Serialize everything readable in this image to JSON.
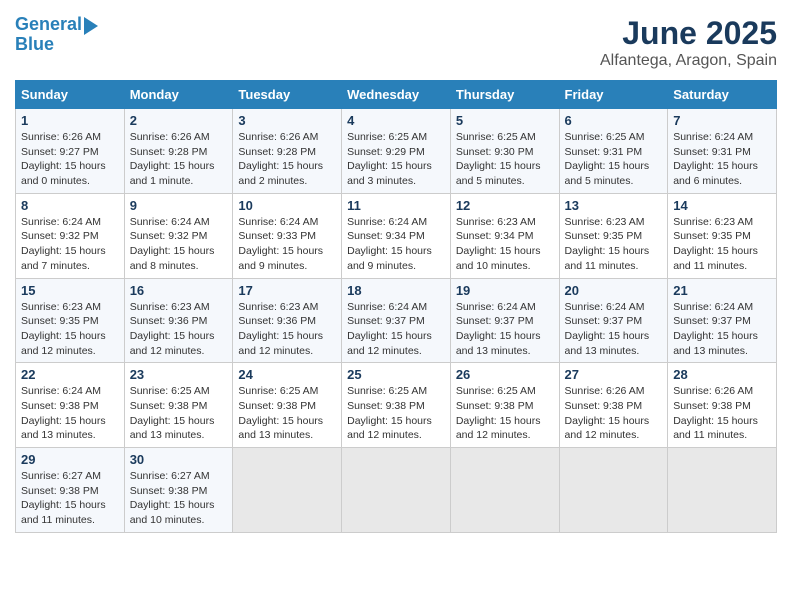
{
  "logo": {
    "line1": "General",
    "line2": "Blue"
  },
  "title": "June 2025",
  "subtitle": "Alfantega, Aragon, Spain",
  "days_of_week": [
    "Sunday",
    "Monday",
    "Tuesday",
    "Wednesday",
    "Thursday",
    "Friday",
    "Saturday"
  ],
  "weeks": [
    [
      {
        "day": 1,
        "info": "Sunrise: 6:26 AM\nSunset: 9:27 PM\nDaylight: 15 hours\nand 0 minutes."
      },
      {
        "day": 2,
        "info": "Sunrise: 6:26 AM\nSunset: 9:28 PM\nDaylight: 15 hours\nand 1 minute."
      },
      {
        "day": 3,
        "info": "Sunrise: 6:26 AM\nSunset: 9:28 PM\nDaylight: 15 hours\nand 2 minutes."
      },
      {
        "day": 4,
        "info": "Sunrise: 6:25 AM\nSunset: 9:29 PM\nDaylight: 15 hours\nand 3 minutes."
      },
      {
        "day": 5,
        "info": "Sunrise: 6:25 AM\nSunset: 9:30 PM\nDaylight: 15 hours\nand 5 minutes."
      },
      {
        "day": 6,
        "info": "Sunrise: 6:25 AM\nSunset: 9:31 PM\nDaylight: 15 hours\nand 5 minutes."
      },
      {
        "day": 7,
        "info": "Sunrise: 6:24 AM\nSunset: 9:31 PM\nDaylight: 15 hours\nand 6 minutes."
      }
    ],
    [
      {
        "day": 8,
        "info": "Sunrise: 6:24 AM\nSunset: 9:32 PM\nDaylight: 15 hours\nand 7 minutes."
      },
      {
        "day": 9,
        "info": "Sunrise: 6:24 AM\nSunset: 9:32 PM\nDaylight: 15 hours\nand 8 minutes."
      },
      {
        "day": 10,
        "info": "Sunrise: 6:24 AM\nSunset: 9:33 PM\nDaylight: 15 hours\nand 9 minutes."
      },
      {
        "day": 11,
        "info": "Sunrise: 6:24 AM\nSunset: 9:34 PM\nDaylight: 15 hours\nand 9 minutes."
      },
      {
        "day": 12,
        "info": "Sunrise: 6:23 AM\nSunset: 9:34 PM\nDaylight: 15 hours\nand 10 minutes."
      },
      {
        "day": 13,
        "info": "Sunrise: 6:23 AM\nSunset: 9:35 PM\nDaylight: 15 hours\nand 11 minutes."
      },
      {
        "day": 14,
        "info": "Sunrise: 6:23 AM\nSunset: 9:35 PM\nDaylight: 15 hours\nand 11 minutes."
      }
    ],
    [
      {
        "day": 15,
        "info": "Sunrise: 6:23 AM\nSunset: 9:35 PM\nDaylight: 15 hours\nand 12 minutes."
      },
      {
        "day": 16,
        "info": "Sunrise: 6:23 AM\nSunset: 9:36 PM\nDaylight: 15 hours\nand 12 minutes."
      },
      {
        "day": 17,
        "info": "Sunrise: 6:23 AM\nSunset: 9:36 PM\nDaylight: 15 hours\nand 12 minutes."
      },
      {
        "day": 18,
        "info": "Sunrise: 6:24 AM\nSunset: 9:37 PM\nDaylight: 15 hours\nand 12 minutes."
      },
      {
        "day": 19,
        "info": "Sunrise: 6:24 AM\nSunset: 9:37 PM\nDaylight: 15 hours\nand 13 minutes."
      },
      {
        "day": 20,
        "info": "Sunrise: 6:24 AM\nSunset: 9:37 PM\nDaylight: 15 hours\nand 13 minutes."
      },
      {
        "day": 21,
        "info": "Sunrise: 6:24 AM\nSunset: 9:37 PM\nDaylight: 15 hours\nand 13 minutes."
      }
    ],
    [
      {
        "day": 22,
        "info": "Sunrise: 6:24 AM\nSunset: 9:38 PM\nDaylight: 15 hours\nand 13 minutes."
      },
      {
        "day": 23,
        "info": "Sunrise: 6:25 AM\nSunset: 9:38 PM\nDaylight: 15 hours\nand 13 minutes."
      },
      {
        "day": 24,
        "info": "Sunrise: 6:25 AM\nSunset: 9:38 PM\nDaylight: 15 hours\nand 13 minutes."
      },
      {
        "day": 25,
        "info": "Sunrise: 6:25 AM\nSunset: 9:38 PM\nDaylight: 15 hours\nand 12 minutes."
      },
      {
        "day": 26,
        "info": "Sunrise: 6:25 AM\nSunset: 9:38 PM\nDaylight: 15 hours\nand 12 minutes."
      },
      {
        "day": 27,
        "info": "Sunrise: 6:26 AM\nSunset: 9:38 PM\nDaylight: 15 hours\nand 12 minutes."
      },
      {
        "day": 28,
        "info": "Sunrise: 6:26 AM\nSunset: 9:38 PM\nDaylight: 15 hours\nand 11 minutes."
      }
    ],
    [
      {
        "day": 29,
        "info": "Sunrise: 6:27 AM\nSunset: 9:38 PM\nDaylight: 15 hours\nand 11 minutes."
      },
      {
        "day": 30,
        "info": "Sunrise: 6:27 AM\nSunset: 9:38 PM\nDaylight: 15 hours\nand 10 minutes."
      },
      {
        "day": null,
        "info": ""
      },
      {
        "day": null,
        "info": ""
      },
      {
        "day": null,
        "info": ""
      },
      {
        "day": null,
        "info": ""
      },
      {
        "day": null,
        "info": ""
      }
    ]
  ]
}
